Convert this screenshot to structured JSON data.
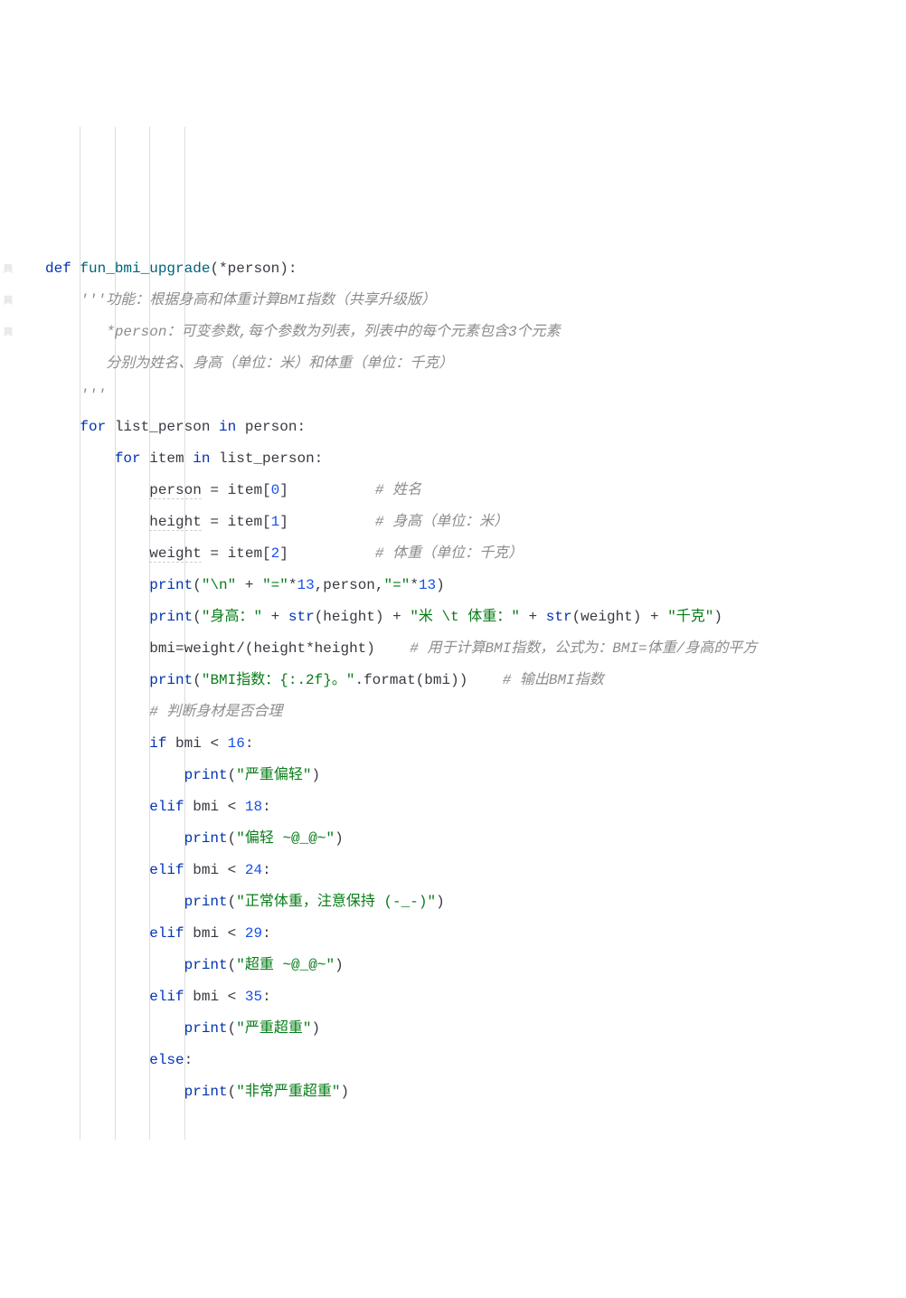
{
  "code": {
    "lines": [
      {
        "indent": 0,
        "tokens": [
          {
            "t": "kw",
            "v": "def "
          },
          {
            "t": "fn",
            "v": "fun_bmi_upgrade"
          },
          {
            "t": "op",
            "v": "(*"
          },
          {
            "t": "param",
            "v": "person"
          },
          {
            "t": "op",
            "v": "):"
          }
        ]
      },
      {
        "indent": 1,
        "tokens": [
          {
            "t": "comment",
            "v": "'''功能：根据身高和体重计算BMI指数（共享升级版）"
          }
        ]
      },
      {
        "indent": 1,
        "tokens": [
          {
            "t": "comment",
            "v": "   *person：可变参数,每个参数为列表，列表中的每个元素包含3个元素"
          }
        ]
      },
      {
        "indent": 1,
        "tokens": [
          {
            "t": "comment",
            "v": "   分别为姓名、身高（单位：米）和体重（单位：千克）"
          }
        ]
      },
      {
        "indent": 1,
        "tokens": [
          {
            "t": "comment",
            "v": "'''"
          }
        ]
      },
      {
        "indent": 1,
        "tokens": [
          {
            "t": "kw",
            "v": "for "
          },
          {
            "t": "ident",
            "v": "list_person "
          },
          {
            "t": "kw",
            "v": "in "
          },
          {
            "t": "ident",
            "v": "person"
          },
          {
            "t": "op",
            "v": ":"
          }
        ]
      },
      {
        "indent": 2,
        "tokens": [
          {
            "t": "kw",
            "v": "for "
          },
          {
            "t": "ident",
            "v": "item "
          },
          {
            "t": "kw",
            "v": "in "
          },
          {
            "t": "ident",
            "v": "list_person"
          },
          {
            "t": "op",
            "v": ":"
          }
        ]
      },
      {
        "indent": 3,
        "tokens": [
          {
            "t": "ident",
            "v": "person",
            "d": true
          },
          {
            "t": "op",
            "v": " = "
          },
          {
            "t": "ident",
            "v": "item"
          },
          {
            "t": "op",
            "v": "["
          },
          {
            "t": "num",
            "v": "0"
          },
          {
            "t": "op",
            "v": "]          "
          },
          {
            "t": "comment",
            "v": "# 姓名"
          }
        ]
      },
      {
        "indent": 3,
        "tokens": [
          {
            "t": "ident",
            "v": "height",
            "d": true
          },
          {
            "t": "op",
            "v": " = "
          },
          {
            "t": "ident",
            "v": "item"
          },
          {
            "t": "op",
            "v": "["
          },
          {
            "t": "num",
            "v": "1"
          },
          {
            "t": "op",
            "v": "]          "
          },
          {
            "t": "comment",
            "v": "# 身高（单位：米）"
          }
        ]
      },
      {
        "indent": 3,
        "tokens": [
          {
            "t": "ident",
            "v": "weight",
            "d": true
          },
          {
            "t": "op",
            "v": " = "
          },
          {
            "t": "ident",
            "v": "item"
          },
          {
            "t": "op",
            "v": "["
          },
          {
            "t": "num",
            "v": "2"
          },
          {
            "t": "op",
            "v": "]          "
          },
          {
            "t": "comment",
            "v": "# 体重（单位：千克）"
          }
        ]
      },
      {
        "indent": 3,
        "tokens": [
          {
            "t": "builtin",
            "v": "print"
          },
          {
            "t": "op",
            "v": "("
          },
          {
            "t": "str",
            "v": "\"\\n\""
          },
          {
            "t": "op",
            "v": " + "
          },
          {
            "t": "str",
            "v": "\"=\""
          },
          {
            "t": "op",
            "v": "*"
          },
          {
            "t": "num",
            "v": "13"
          },
          {
            "t": "op",
            "v": ","
          },
          {
            "t": "ident",
            "v": "person"
          },
          {
            "t": "op",
            "v": ","
          },
          {
            "t": "str",
            "v": "\"=\""
          },
          {
            "t": "op",
            "v": "*"
          },
          {
            "t": "num",
            "v": "13"
          },
          {
            "t": "op",
            "v": ")"
          }
        ]
      },
      {
        "indent": 3,
        "tokens": [
          {
            "t": "builtin",
            "v": "print"
          },
          {
            "t": "op",
            "v": "("
          },
          {
            "t": "str",
            "v": "\"身高：\""
          },
          {
            "t": "op",
            "v": " + "
          },
          {
            "t": "builtin",
            "v": "str"
          },
          {
            "t": "op",
            "v": "("
          },
          {
            "t": "ident",
            "v": "height"
          },
          {
            "t": "op",
            "v": ") + "
          },
          {
            "t": "str",
            "v": "\"米 \\t 体重：\""
          },
          {
            "t": "op",
            "v": " + "
          },
          {
            "t": "builtin",
            "v": "str"
          },
          {
            "t": "op",
            "v": "("
          },
          {
            "t": "ident",
            "v": "weight"
          },
          {
            "t": "op",
            "v": ") + "
          },
          {
            "t": "str",
            "v": "\"千克\""
          },
          {
            "t": "op",
            "v": ")"
          }
        ]
      },
      {
        "indent": 3,
        "tokens": [
          {
            "t": "ident",
            "v": "bmi"
          },
          {
            "t": "op",
            "v": "="
          },
          {
            "t": "ident",
            "v": "weight"
          },
          {
            "t": "op",
            "v": "/("
          },
          {
            "t": "ident",
            "v": "height"
          },
          {
            "t": "op",
            "v": "*"
          },
          {
            "t": "ident",
            "v": "height"
          },
          {
            "t": "op",
            "v": ")    "
          },
          {
            "t": "comment",
            "v": "# 用于计算BMI指数，公式为：BMI=体重/身高的平方"
          }
        ]
      },
      {
        "indent": 3,
        "tokens": [
          {
            "t": "builtin",
            "v": "print"
          },
          {
            "t": "op",
            "v": "("
          },
          {
            "t": "str",
            "v": "\"BMI指数：{:.2f}。\""
          },
          {
            "t": "op",
            "v": "."
          },
          {
            "t": "ident",
            "v": "format"
          },
          {
            "t": "op",
            "v": "("
          },
          {
            "t": "ident",
            "v": "bmi"
          },
          {
            "t": "op",
            "v": "))    "
          },
          {
            "t": "comment",
            "v": "# 输出BMI指数"
          }
        ]
      },
      {
        "indent": 3,
        "tokens": [
          {
            "t": "comment",
            "v": "# 判断身材是否合理"
          }
        ]
      },
      {
        "indent": 3,
        "tokens": [
          {
            "t": "kw",
            "v": "if "
          },
          {
            "t": "ident",
            "v": "bmi"
          },
          {
            "t": "op",
            "v": " < "
          },
          {
            "t": "num",
            "v": "16"
          },
          {
            "t": "op",
            "v": ":"
          }
        ]
      },
      {
        "indent": 4,
        "tokens": [
          {
            "t": "builtin",
            "v": "print"
          },
          {
            "t": "op",
            "v": "("
          },
          {
            "t": "str",
            "v": "\"严重偏轻\""
          },
          {
            "t": "op",
            "v": ")"
          }
        ]
      },
      {
        "indent": 3,
        "tokens": [
          {
            "t": "kw",
            "v": "elif "
          },
          {
            "t": "ident",
            "v": "bmi"
          },
          {
            "t": "op",
            "v": " < "
          },
          {
            "t": "num",
            "v": "18"
          },
          {
            "t": "op",
            "v": ":"
          }
        ]
      },
      {
        "indent": 4,
        "tokens": [
          {
            "t": "builtin",
            "v": "print"
          },
          {
            "t": "op",
            "v": "("
          },
          {
            "t": "str",
            "v": "\"偏轻 ~@_@~\""
          },
          {
            "t": "op",
            "v": ")"
          }
        ]
      },
      {
        "indent": 3,
        "tokens": [
          {
            "t": "kw",
            "v": "elif "
          },
          {
            "t": "ident",
            "v": "bmi"
          },
          {
            "t": "op",
            "v": " < "
          },
          {
            "t": "num",
            "v": "24"
          },
          {
            "t": "op",
            "v": ":"
          }
        ]
      },
      {
        "indent": 4,
        "tokens": [
          {
            "t": "builtin",
            "v": "print"
          },
          {
            "t": "op",
            "v": "("
          },
          {
            "t": "str",
            "v": "\"正常体重，注意保持 (-_-)\""
          },
          {
            "t": "op",
            "v": ")"
          }
        ]
      },
      {
        "indent": 3,
        "tokens": [
          {
            "t": "kw",
            "v": "elif "
          },
          {
            "t": "ident",
            "v": "bmi"
          },
          {
            "t": "op",
            "v": " < "
          },
          {
            "t": "num",
            "v": "29"
          },
          {
            "t": "op",
            "v": ":"
          }
        ]
      },
      {
        "indent": 4,
        "tokens": [
          {
            "t": "builtin",
            "v": "print"
          },
          {
            "t": "op",
            "v": "("
          },
          {
            "t": "str",
            "v": "\"超重 ~@_@~\""
          },
          {
            "t": "op",
            "v": ")"
          }
        ]
      },
      {
        "indent": 3,
        "tokens": [
          {
            "t": "kw",
            "v": "elif "
          },
          {
            "t": "ident",
            "v": "bmi"
          },
          {
            "t": "op",
            "v": " < "
          },
          {
            "t": "num",
            "v": "35"
          },
          {
            "t": "op",
            "v": ":"
          }
        ]
      },
      {
        "indent": 4,
        "tokens": [
          {
            "t": "builtin",
            "v": "print"
          },
          {
            "t": "op",
            "v": "("
          },
          {
            "t": "str",
            "v": "\"严重超重\""
          },
          {
            "t": "op",
            "v": ")"
          }
        ]
      },
      {
        "indent": 3,
        "tokens": [
          {
            "t": "kw",
            "v": "else"
          },
          {
            "t": "op",
            "v": ":"
          }
        ]
      },
      {
        "indent": 4,
        "tokens": [
          {
            "t": "builtin",
            "v": "print"
          },
          {
            "t": "op",
            "v": "("
          },
          {
            "t": "str",
            "v": "\"非常严重超重\""
          },
          {
            "t": "op",
            "v": ")"
          }
        ]
      }
    ],
    "indent_unit": "    ",
    "gutter_icons_on_lines": [
      4,
      5,
      6
    ]
  },
  "colors": {
    "keyword": "#0033b3",
    "function": "#00627a",
    "string": "#067d17",
    "number": "#1750eb",
    "comment": "#8c8c8c",
    "text": "#383a42",
    "guide": "rgba(200,200,200,0.6)",
    "background": "#ffffff"
  }
}
